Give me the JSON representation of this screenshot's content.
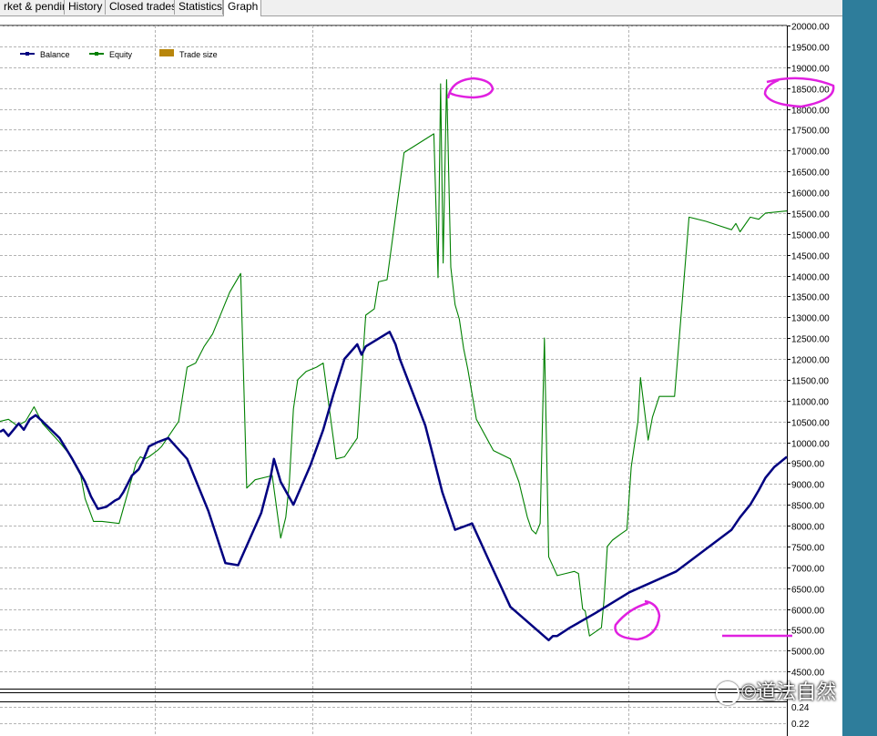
{
  "tabs": [
    {
      "label": "rket & pending"
    },
    {
      "label": "History"
    },
    {
      "label": "Closed trades"
    },
    {
      "label": "Statistics"
    },
    {
      "label": "Graph"
    }
  ],
  "watermark": "©道法自然",
  "chart_data": {
    "type": "line",
    "title": "",
    "xlabel": "",
    "ylabel": "",
    "legend": [
      {
        "name": "Balance",
        "color": "#000080"
      },
      {
        "name": "Equity",
        "color": "#008000"
      },
      {
        "name": "Trade size",
        "color": "#b8860b"
      }
    ],
    "legend_position": "top-left",
    "grid": true,
    "ylim": [
      4000,
      20000
    ],
    "yticks": [
      "20000.00",
      "19500.00",
      "19000.00",
      "18500.00",
      "18000.00",
      "17500.00",
      "17000.00",
      "16500.00",
      "16000.00",
      "15500.00",
      "15000.00",
      "14500.00",
      "14000.00",
      "13500.00",
      "13000.00",
      "12500.00",
      "12000.00",
      "11500.00",
      "11000.00",
      "10500.00",
      "10000.00",
      "9500.00",
      "9000.00",
      "8500.00",
      "8000.00",
      "7500.00",
      "7000.00",
      "6500.00",
      "6000.00",
      "5500.00",
      "5000.00",
      "4500.00"
    ],
    "subpanel_ticks": [
      "0.24",
      "0.22"
    ],
    "series": [
      {
        "name": "Balance",
        "color": "#000080",
        "x": [
          0,
          4,
          10,
          16,
          22,
          28,
          35,
          42,
          50,
          70,
          85,
          100,
          107,
          115,
          125,
          135,
          140,
          145,
          150,
          155,
          163,
          168,
          172,
          175,
          185,
          198,
          220,
          245,
          265,
          280,
          307,
          318,
          322,
          330,
          345,
          365,
          380,
          392,
          405,
          420,
          425,
          430,
          458,
          465,
          470,
          485,
          500,
          510,
          520,
          535,
          555,
          575,
          600,
          645,
          650,
          655,
          670,
          700,
          740,
          795,
          860,
          870,
          882,
          892,
          900,
          910,
          925
        ],
        "y": [
          10250,
          10300,
          10150,
          10300,
          10450,
          10300,
          10550,
          10650,
          10500,
          10100,
          9600,
          9050,
          8700,
          8400,
          8450,
          8600,
          8650,
          8800,
          9000,
          9200,
          9350,
          9550,
          9750,
          9900,
          10000,
          10100,
          9600,
          8350,
          7100,
          7050,
          8300,
          9150,
          9600,
          9050,
          8500,
          9450,
          10300,
          11150,
          12000,
          12350,
          12100,
          12300,
          12650,
          12350,
          12000,
          11200,
          10400,
          9600,
          8800,
          7900,
          8050,
          7150,
          6050,
          5250,
          5350,
          5350,
          5550,
          5900,
          6400,
          6900,
          7900,
          8200,
          8500,
          8850,
          9150,
          9400,
          9650
        ]
      },
      {
        "name": "Equity",
        "color": "#008000",
        "x": [
          0,
          10,
          20,
          30,
          40,
          50,
          70,
          80,
          95,
          100,
          110,
          120,
          140,
          160,
          165,
          170,
          175,
          185,
          190,
          200,
          210,
          220,
          230,
          240,
          250,
          260,
          270,
          283,
          290,
          300,
          320,
          330,
          336,
          340,
          345,
          350,
          360,
          372,
          380,
          395,
          405,
          420,
          430,
          440,
          445,
          455,
          475,
          510,
          515,
          518,
          521,
          525,
          530,
          535,
          540,
          545,
          550,
          560,
          580,
          600,
          610,
          620,
          625,
          630,
          635,
          640,
          645,
          655,
          665,
          675,
          680,
          685,
          688,
          693,
          700,
          707,
          710,
          714,
          720,
          730,
          737,
          742,
          750,
          753,
          762,
          767,
          775,
          790,
          793,
          810,
          830,
          845,
          860,
          865,
          870,
          882,
          892,
          900,
          925
        ],
        "y": [
          10500,
          10550,
          10400,
          10500,
          10850,
          10450,
          10000,
          9750,
          9200,
          8650,
          8100,
          8100,
          8050,
          9500,
          9650,
          9600,
          9650,
          9800,
          9900,
          10200,
          10500,
          11800,
          11900,
          12300,
          12600,
          13100,
          13600,
          14050,
          8900,
          9100,
          9200,
          7700,
          8200,
          9000,
          10800,
          11500,
          11700,
          11800,
          11900,
          9600,
          9650,
          10100,
          13050,
          13200,
          13850,
          13900,
          16950,
          17400,
          13950,
          18600,
          14300,
          18700,
          14200,
          13300,
          12950,
          12250,
          11750,
          10550,
          9800,
          9600,
          9050,
          8200,
          7900,
          7800,
          8050,
          12500,
          7250,
          6800,
          6850,
          6900,
          6850,
          6000,
          5950,
          5350,
          5450,
          5550,
          6200,
          7500,
          7650,
          7800,
          7900,
          9400,
          10500,
          11550,
          10050,
          10600,
          11100,
          11100,
          11100,
          15400,
          15300,
          15200,
          15100,
          15250,
          15050,
          15400,
          15350,
          15500,
          15550
        ]
      }
    ]
  }
}
